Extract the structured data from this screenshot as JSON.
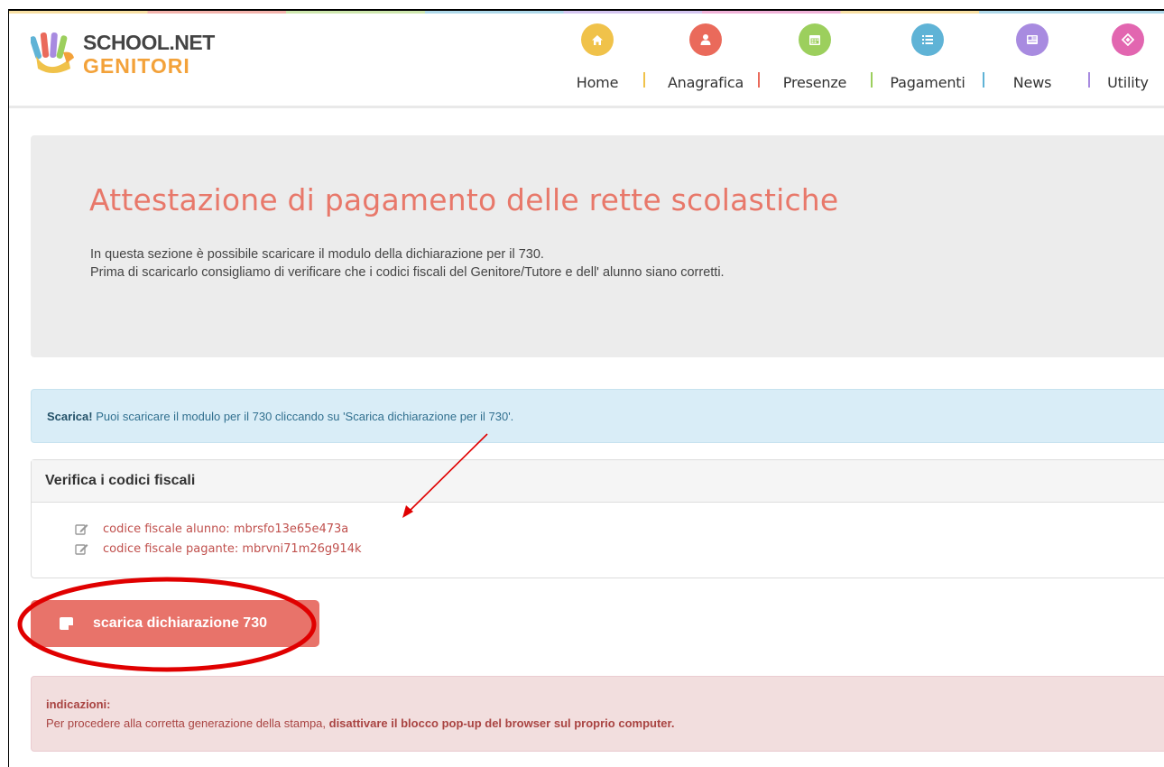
{
  "header": {
    "logo_line1": "SCHOOL.NET",
    "logo_line2": "GENITORI",
    "nav": [
      {
        "label": "Home",
        "icon": "home-icon",
        "color": "#f0c24a"
      },
      {
        "label": "Anagrafica",
        "icon": "user-icon",
        "color": "#ea6a5b"
      },
      {
        "label": "Presenze",
        "icon": "calendar-icon",
        "color": "#9ccf5d"
      },
      {
        "label": "Pagamenti",
        "icon": "list-icon",
        "color": "#5fb3d6"
      },
      {
        "label": "News",
        "icon": "newspaper-icon",
        "color": "#a88be0"
      },
      {
        "label": "Utility",
        "icon": "diamond-icon",
        "color": "#e266b0"
      }
    ]
  },
  "jumbotron": {
    "title": "Attestazione di pagamento delle rette scolastiche",
    "line1": "In questa sezione è possibile scaricare il modulo della dichiarazione per il 730.",
    "line2": "Prima di scaricarlo consigliamo di verificare che i codici fiscali del Genitore/Tutore e dell' alunno siano corretti."
  },
  "alert_info": {
    "strong": "Scarica!",
    "text": " Puoi scaricare il modulo per il 730 cliccando su 'Scarica dichiarazione per il 730'."
  },
  "panel": {
    "heading": "Verifica i codici fiscali",
    "rows": [
      {
        "text": "codice fiscale alunno: mbrsfo13e65e473a"
      },
      {
        "text": "codice fiscale pagante: mbrvni71m26g914k"
      }
    ]
  },
  "button": {
    "label": "scarica dichiarazione 730"
  },
  "alert_danger": {
    "title": "indicazioni:",
    "text": "Per procedere alla corretta generazione della stampa, ",
    "strong": "disattivare il blocco pop-up del browser sul proprio computer."
  },
  "colors": {
    "accent": "#e8786a",
    "annotation": "#e00000"
  }
}
